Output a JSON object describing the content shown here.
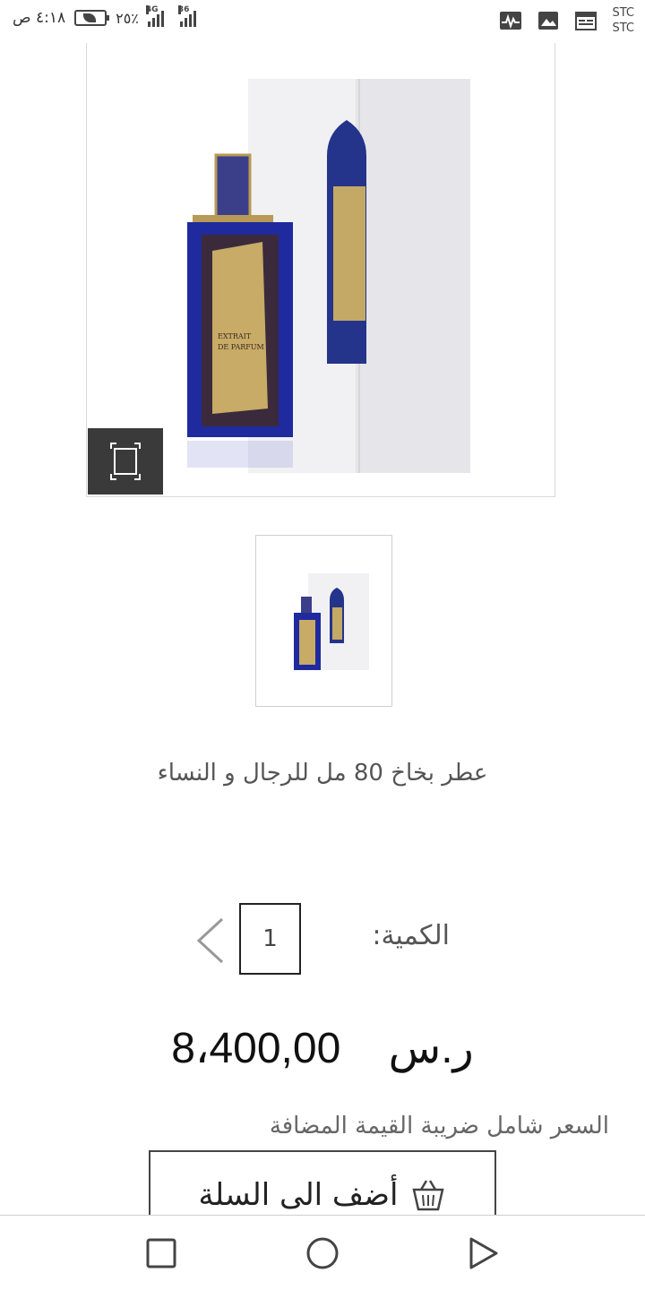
{
  "status_bar": {
    "time": "٤:١٨ ص",
    "battery": "٢٥٪",
    "network_1": "4G",
    "network_2": "36",
    "carrier_1": "STC",
    "carrier_2": "STC",
    "icons": [
      "pulse-icon",
      "image-icon",
      "calendar-icon"
    ]
  },
  "product": {
    "title": "عطر بخاخ 80 مل للرجال و النساء",
    "image_icons": [
      "fullscreen-icon"
    ],
    "label_text": [
      "EXTRAIT",
      "DE PARFUM"
    ]
  },
  "quantity": {
    "label": "الكمية:",
    "value": "1"
  },
  "price": {
    "currency": "ر.س",
    "amount": "8،400,00"
  },
  "vat_note": "السعر شامل ضريبة القيمة المضافة",
  "cart": {
    "add_label": "أضف الى السلة",
    "icon": "basket-icon"
  },
  "navigation": {
    "buttons": [
      "recents-icon",
      "home-icon",
      "back-icon"
    ]
  },
  "colors": {
    "fullscreen_bg": "#3a3a3a",
    "bottle_blue": "#1f2a9e",
    "label_gold": "#b89a56"
  }
}
